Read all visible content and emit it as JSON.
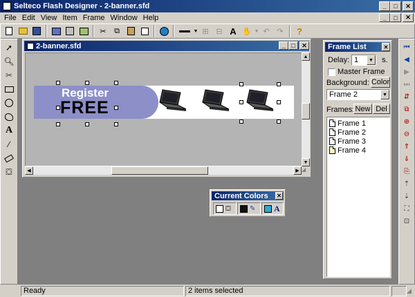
{
  "window": {
    "title": "Selteco Flash Designer - 2-banner.sfd"
  },
  "menu": [
    "File",
    "Edit",
    "View",
    "Item",
    "Frame",
    "Window",
    "Help"
  ],
  "document": {
    "title": "2-banner.sfd"
  },
  "banner": {
    "line1": "Register",
    "line2": "FREE"
  },
  "frame_list": {
    "title": "Frame List",
    "delay_label": "Delay:",
    "delay_value": "1",
    "delay_unit": "s.",
    "master_frame_label": "Master Frame",
    "background_label": "Background:",
    "color_button": "Color",
    "selected_frame": "Frame 2",
    "frames_label": "Frames:",
    "new_button": "New",
    "del_button": "Del",
    "frames": [
      "Frame 1",
      "Frame 2",
      "Frame 3",
      "Frame 4"
    ]
  },
  "current_colors": {
    "title": "Current Colors",
    "text_glyph": "A"
  },
  "status": {
    "left": "Ready",
    "middle": "2 items selected"
  },
  "colors": {
    "banner_blue": "#8c8fc8",
    "workspace": "#808080",
    "canvas": "#b4b4b4",
    "title_dark": "#0a246a",
    "title_light": "#3a6ea5"
  }
}
